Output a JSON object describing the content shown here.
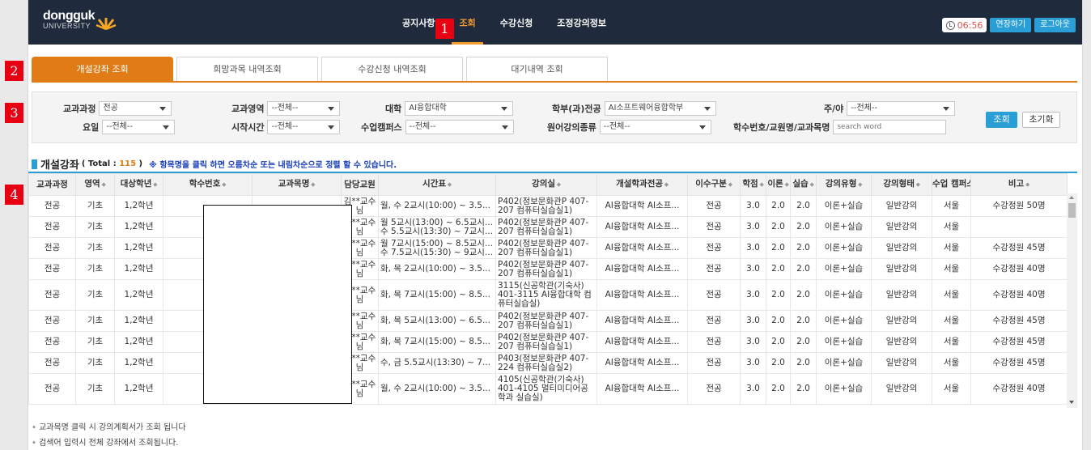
{
  "header": {
    "logo_line1": "dongguk",
    "logo_line2": "UNIVERSITY",
    "nav": [
      "공지사항",
      "조회",
      "수강신청",
      "조정강의정보"
    ],
    "timer": "06:56",
    "extend_label": "연장하기",
    "logout_label": "로그아웃"
  },
  "markers": [
    "1",
    "2",
    "3",
    "4"
  ],
  "tabs": [
    "개설강좌 조회",
    "희망과목 내역조회",
    "수강신청 내역조회",
    "대기내역 조회"
  ],
  "filters": {
    "course_level": {
      "label": "교과과정",
      "value": "전공"
    },
    "subject_area": {
      "label": "교과영역",
      "value": "--전체--"
    },
    "college": {
      "label": "대학",
      "value": "AI융합대학"
    },
    "department": {
      "label": "학부(과)전공",
      "value": "AI소프트웨어융합학부"
    },
    "day_night": {
      "label": "주/야",
      "value": "--전체--"
    },
    "weekday": {
      "label": "요일",
      "value": "--전체--"
    },
    "start_time": {
      "label": "시작시간",
      "value": "--전체--"
    },
    "campus": {
      "label": "수업캠퍼스",
      "value": "--전체--"
    },
    "english_type": {
      "label": "원어강의종류",
      "value": "--전체--"
    },
    "keyword": {
      "label": "학수번호/교원명/교과목명",
      "placeholder": "search word"
    },
    "search_label": "조회",
    "reset_label": "초기화"
  },
  "result": {
    "title": "개설강좌",
    "total_prefix": "( Total : ",
    "total": "115",
    "total_suffix": " )",
    "note": "※ 항목명을 클릭 하면 오름차순 또는 내림차순으로 정렬 할 수 있습니다."
  },
  "table": {
    "columns": [
      "교과과정",
      "영역",
      "대상학년",
      "학수번호",
      "교과목명",
      "담당교원",
      "시간표",
      "강의실",
      "개설학과전공",
      "이수구분",
      "학점",
      "이론",
      "실습",
      "강의유형",
      "강의형태",
      "수업 캠퍼스",
      "비고"
    ],
    "rows": [
      [
        "전공",
        "기초",
        "1,2학년",
        "",
        "",
        "김**교수님",
        "월, 수 2교시(10:00) ~ 3.5...",
        "P402(정보문화관P 407-207 컴퓨터실습실1)",
        "AI융합대학 AI소프...",
        "전공",
        "3.0",
        "2.0",
        "2.0",
        "이론+실습",
        "일반강의",
        "서울",
        "수강정원 50명"
      ],
      [
        "전공",
        "기초",
        "1,2학년",
        "",
        "",
        "김**교수님",
        "월 5교시(13:00) ~ 6.5교시... 수 5.5교시(13:30) ~ 7교시...",
        "P402(정보문화관P 407-207 컴퓨터실습실1)",
        "AI융합대학 AI소프...",
        "전공",
        "3.0",
        "2.0",
        "2.0",
        "이론+실습",
        "일반강의",
        "서울",
        ""
      ],
      [
        "전공",
        "기초",
        "1,2학년",
        "",
        "",
        "김**교수님",
        "월 7교시(15:00) ~ 8.5교시... 수 7.5교시(15:30) ~ 9교시...",
        "P402(정보문화관P 407-207 컴퓨터실습실1)",
        "AI융합대학 AI소프...",
        "전공",
        "3.0",
        "2.0",
        "2.0",
        "이론+실습",
        "일반강의",
        "서울",
        "수강정원 45명"
      ],
      [
        "전공",
        "기초",
        "1,2학년",
        "",
        "",
        "김**교수님",
        "화, 목 2교시(10:00) ~ 3.5...",
        "P402(정보문화관P 407-207 컴퓨터실습실1)",
        "AI융합대학 AI소프...",
        "전공",
        "3.0",
        "2.0",
        "2.0",
        "이론+실습",
        "일반강의",
        "서울",
        "수강정원 40명"
      ],
      [
        "전공",
        "기초",
        "1,2학년",
        "",
        "",
        "김**교수님",
        "화, 목 7교시(15:00) ~ 8.5...",
        "3115(신공학관(기숙사) 401-3115 AI융합대학 컴퓨터실습실)",
        "AI융합대학 AI소프...",
        "전공",
        "3.0",
        "2.0",
        "2.0",
        "이론+실습",
        "일반강의",
        "서울",
        "수강정원 40명"
      ],
      [
        "전공",
        "기초",
        "1,2학년",
        "",
        "",
        "김**교수님",
        "화, 목 5교시(13:00) ~ 6.5...",
        "P402(정보문화관P 407-207 컴퓨터실습실1)",
        "AI융합대학 AI소프...",
        "전공",
        "3.0",
        "2.0",
        "2.0",
        "이론+실습",
        "일반강의",
        "서울",
        "수강정원 45명"
      ],
      [
        "전공",
        "기초",
        "1,2학년",
        "",
        "",
        "김**교수님",
        "화, 목 7교시(15:00) ~ 8.5...",
        "P402(정보문화관P 407-207 컴퓨터실습실1)",
        "AI융합대학 AI소프...",
        "전공",
        "3.0",
        "2.0",
        "2.0",
        "이론+실습",
        "일반강의",
        "서울",
        "수강정원 45명"
      ],
      [
        "전공",
        "기초",
        "1,2학년",
        "",
        "",
        "김**교수님",
        "수, 금 5.5교시(13:30) ~ 7...",
        "P403(정보문화관P 407-224 컴퓨터실습실2)",
        "AI융합대학 AI소프...",
        "전공",
        "3.0",
        "2.0",
        "2.0",
        "이론+실습",
        "일반강의",
        "서울",
        "수강정원 45명"
      ],
      [
        "전공",
        "기초",
        "1,2학년",
        "",
        "",
        "김**교수님",
        "월, 수 2교시(10:00) ~ 3.5...",
        "4105(신공학관(기숙사) 401-4105 멀티미디어공학과 실습실)",
        "AI융합대학 AI소프...",
        "전공",
        "3.0",
        "2.0",
        "2.0",
        "이론+실습",
        "일반강의",
        "서울",
        "수강정원 40명"
      ]
    ]
  },
  "footer_notes": [
    "교과목명 클릭 시 강의계획서가 조회 됩니다",
    "검색어 입력시 전체 강좌에서 조회됩니다."
  ]
}
